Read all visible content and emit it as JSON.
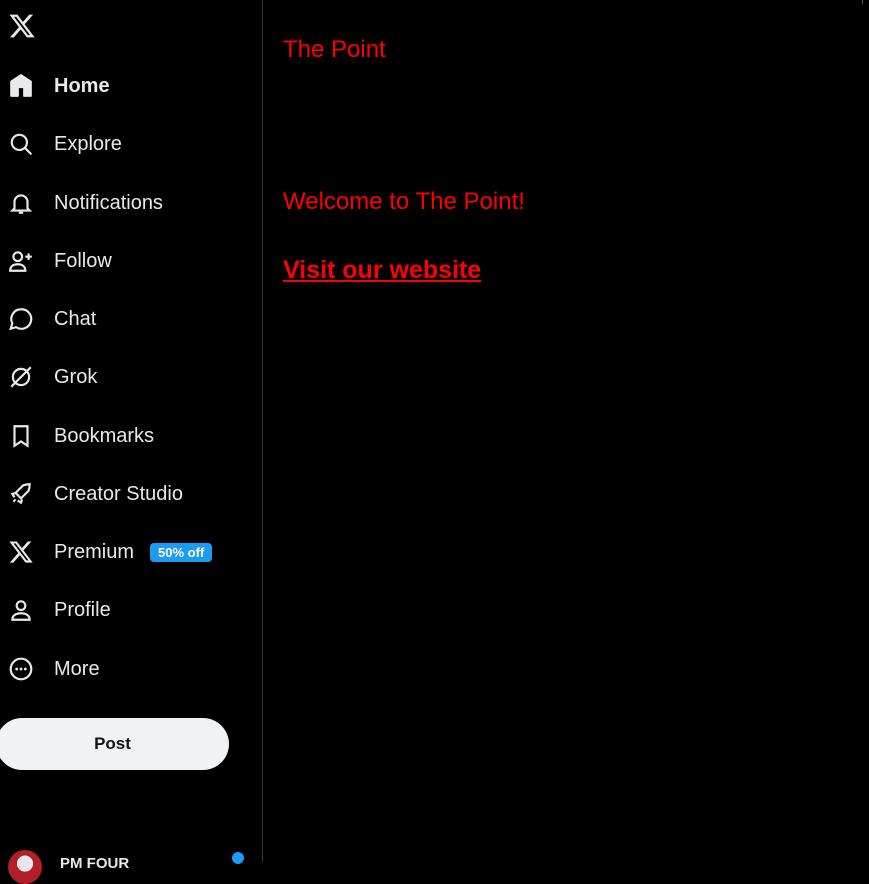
{
  "sidebar": {
    "logo": "x-logo",
    "items": [
      {
        "label": "Home",
        "icon": "home-icon"
      },
      {
        "label": "Explore",
        "icon": "search-icon"
      },
      {
        "label": "Notifications",
        "icon": "bell-icon"
      },
      {
        "label": "Follow",
        "icon": "person-add-icon"
      },
      {
        "label": "Chat",
        "icon": "chat-bubble-icon"
      },
      {
        "label": "Grok",
        "icon": "grok-icon"
      },
      {
        "label": "Bookmarks",
        "icon": "bookmark-icon"
      },
      {
        "label": "Creator Studio",
        "icon": "rocket-icon"
      },
      {
        "label": "Premium",
        "icon": "x-icon",
        "badge": "50% off"
      },
      {
        "label": "Profile",
        "icon": "person-icon"
      },
      {
        "label": "More",
        "icon": "more-circle-icon"
      }
    ],
    "post_label": "Post",
    "account_name": "PM FOUR"
  },
  "main": {
    "title": "The Point",
    "welcome": "Welcome to The Point!",
    "link_label": "Visit our website"
  },
  "colors": {
    "background": "#000000",
    "accent_red": "#ff0000",
    "badge_blue": "#1d9bf0",
    "post_button": "#eff3f4"
  }
}
